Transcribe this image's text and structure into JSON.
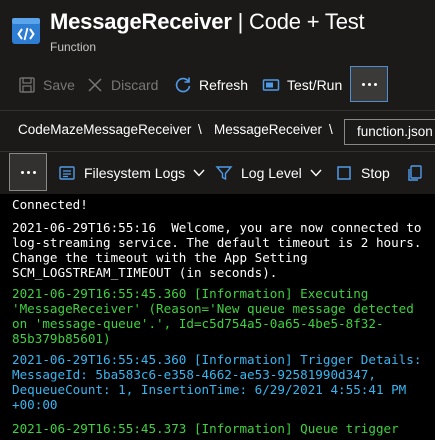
{
  "header": {
    "app_name": "MessageReceiver",
    "separator_title": " | Code + Test",
    "subtitle": "Function"
  },
  "toolbar": {
    "save_label": "Save",
    "discard_label": "Discard",
    "refresh_label": "Refresh",
    "test_run_label": "Test/Run"
  },
  "breadcrumb": {
    "item1": "CodeMazeMessageReceiver",
    "sep": "\\",
    "item2": "MessageReceiver",
    "file_tab": "function.json"
  },
  "log_toolbar": {
    "filesystem_logs_label": "Filesystem Logs",
    "log_level_label": "Log Level",
    "stop_label": "Stop"
  },
  "console": {
    "lines": [
      "Connected!",
      "2021-06-29T16:55:16  Welcome, you are now connected to",
      "log-streaming service. The default timeout is 2 hours.",
      "Change the timeout with the App Setting",
      "SCM_LOGSTREAM_TIMEOUT (in seconds).",
      "2021-06-29T16:55:45.360 [Information] Executing",
      "'MessageReceiver' (Reason='New queue message detected",
      "on 'message-queue'.', Id=c5d754a5-0a65-4be5-8f32-",
      "85b379b85601)",
      "2021-06-29T16:55:45.360 [Information] Trigger Details:",
      "MessageId: 5ba583c6-e358-4662-ae53-92581990d347,",
      "DequeueCount: 1, InsertionTime: 6/29/2021 4:55:41 PM",
      "+00:00",
      "2021-06-29T16:55:45.373 [Information] Queue trigger"
    ]
  },
  "colors": {
    "log_green": "#3fd13f",
    "log_cyan": "#38b6f2",
    "accent_blue": "#4f8fd0"
  }
}
